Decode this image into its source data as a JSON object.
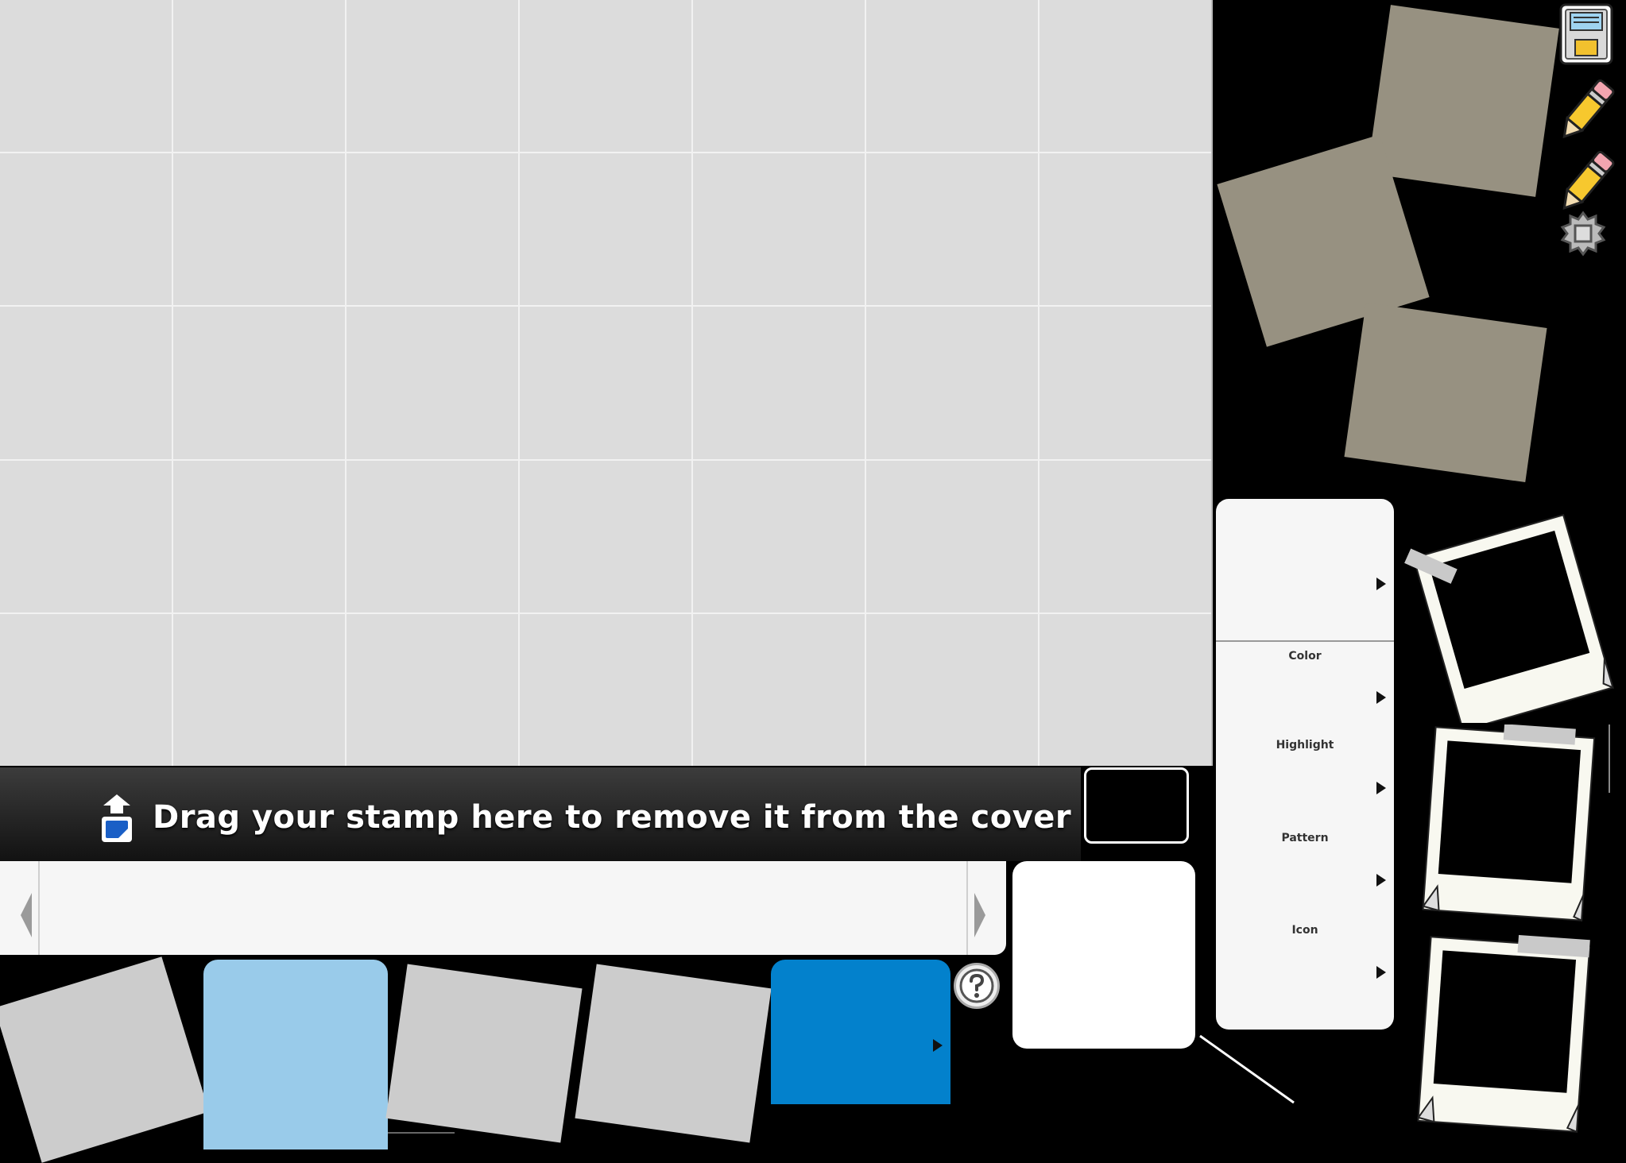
{
  "trash_bar": {
    "label": "Drag your stamp here to remove it from the cover"
  },
  "menu": {
    "items": [
      {
        "label": ""
      },
      {
        "label": "Color"
      },
      {
        "label": "Highlight"
      },
      {
        "label": "Pattern"
      },
      {
        "label": "Icon"
      }
    ]
  },
  "toolbar": {
    "icons": [
      "save-icon",
      "pencil-icon",
      "pencil-icon",
      "settings-icon"
    ]
  },
  "colors": {
    "grid": "#dcdcdc",
    "menu_bg": "#f6f6f6",
    "light_blue": "#99cbea",
    "blue": "#0381cc",
    "frame_beige": "#979181"
  }
}
